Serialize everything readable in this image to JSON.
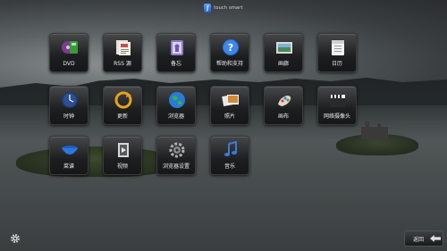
{
  "header": {
    "brand_text": "touch smart"
  },
  "apps": [
    {
      "label": "DVD"
    },
    {
      "label": "RSS 源"
    },
    {
      "label": "备忘"
    },
    {
      "label": "帮助和支持"
    },
    {
      "label": "画廊"
    },
    {
      "label": "日历"
    },
    {
      "label": "时钟"
    },
    {
      "label": "更新"
    },
    {
      "label": "浏览器"
    },
    {
      "label": "照片"
    },
    {
      "label": "画布"
    },
    {
      "label": "网络摄像头"
    },
    {
      "label": "菜谱"
    },
    {
      "label": "视频"
    },
    {
      "label": "浏览器设置"
    },
    {
      "label": "音乐"
    }
  ],
  "footer": {
    "back_label": "返回"
  },
  "colors": {
    "accent_blue": "#1a5fd0",
    "tile_dark": "#1d1e1f"
  }
}
